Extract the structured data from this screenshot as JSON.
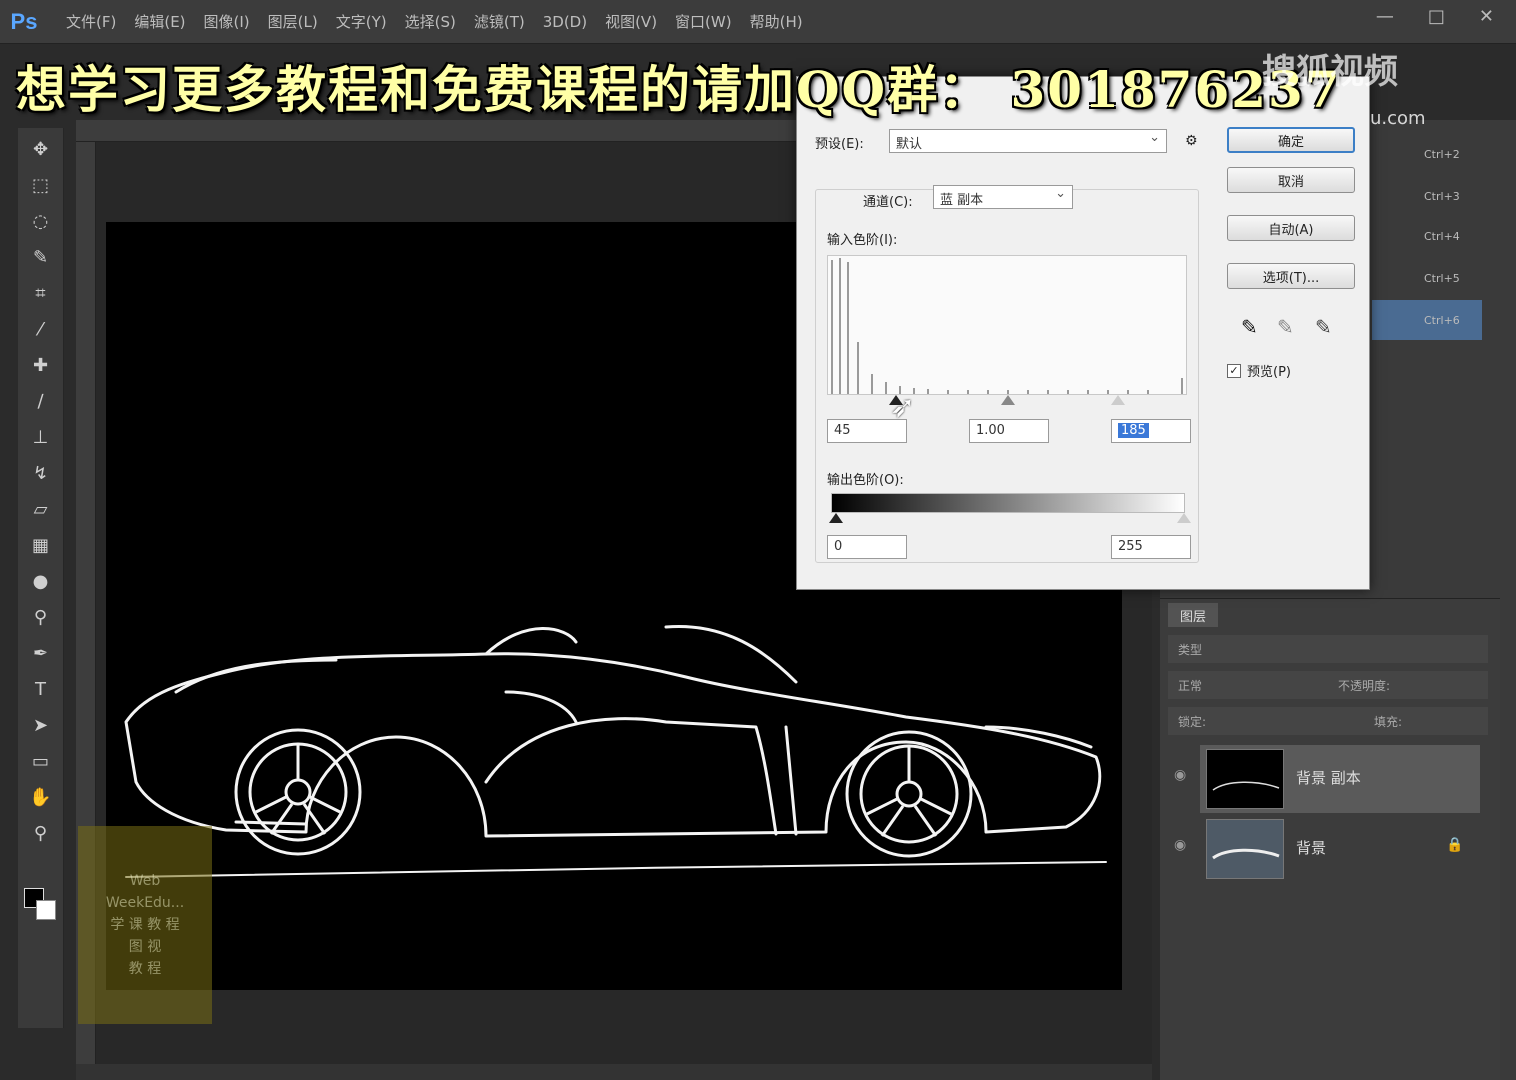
{
  "app": {
    "logo": "Ps"
  },
  "menu": [
    "文件(F)",
    "编辑(E)",
    "图像(I)",
    "图层(L)",
    "文字(Y)",
    "选择(S)",
    "滤镜(T)",
    "3D(D)",
    "视图(V)",
    "窗口(W)",
    "帮助(H)"
  ],
  "window_controls": [
    "—",
    "□",
    "✕"
  ],
  "banner": "想学习更多教程和免费课程的请加QQ群： 301876237",
  "watermark": {
    "brand": "搜狐视频",
    "url": "u.com"
  },
  "sticker_text": [
    "Web",
    "WeekEdu...",
    "学 课 教 程",
    "图 视",
    "教 程"
  ],
  "levels": {
    "preset_label": "预设(E):",
    "preset_value": "默认",
    "channel_label": "通道(C):",
    "channel_value": "蓝 副本",
    "input_levels_label": "输入色阶(I):",
    "input_values": [
      "45",
      "1.00",
      "185"
    ],
    "output_levels_label": "输出色阶(O):",
    "output_values": [
      "0",
      "255"
    ],
    "buttons": {
      "ok": "确定",
      "cancel": "取消",
      "auto": "自动(A)",
      "options": "选项(T)..."
    },
    "preview_label": "预览(P)",
    "preset_menu_icon": "gear-icon"
  },
  "shortcuts": [
    "Ctrl+2",
    "Ctrl+3",
    "Ctrl+4",
    "Ctrl+5",
    "Ctrl+6"
  ],
  "layers": {
    "tab_label": "图层",
    "filter_label": "类型",
    "blend_mode": "正常",
    "opacity_label": "不透明度:",
    "lock_label": "锁定:",
    "fill_label": "填充:",
    "items": [
      {
        "name": "背景 副本",
        "selected": true
      },
      {
        "name": "背景",
        "selected": false,
        "locked": true
      }
    ]
  },
  "colors": {
    "accent": "#3c7fc6",
    "banner_text": "#ffffa6",
    "ps_blue": "#5aa7ff",
    "highlight_row": "#4a6b92"
  }
}
